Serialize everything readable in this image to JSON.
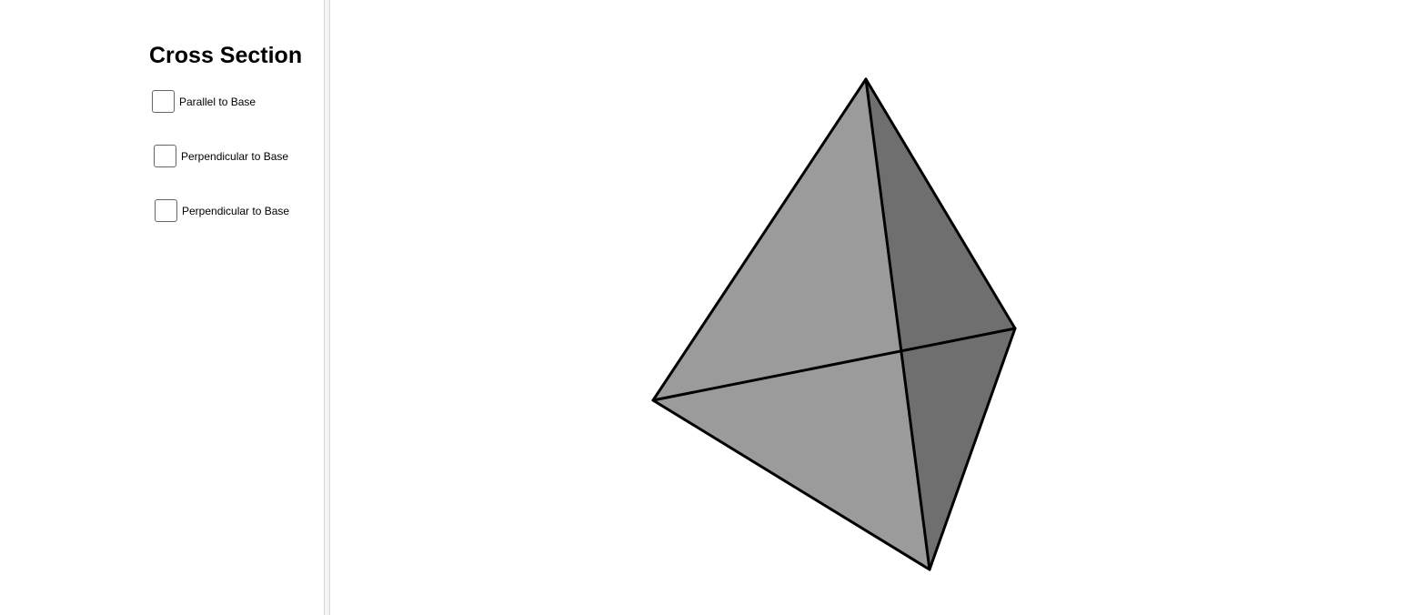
{
  "sidebar": {
    "title": "Cross Section",
    "options": [
      {
        "label": "Parallel to Base",
        "checked": false
      },
      {
        "label": "Perpendicular to Base",
        "checked": false
      },
      {
        "label": "Perpendicular to Base",
        "checked": false
      }
    ]
  },
  "view3d": {
    "shape": "tetrahedron",
    "colors": {
      "front_face": "#9b9b9b",
      "right_face": "#6f6f6f",
      "edge": "#000000"
    }
  }
}
